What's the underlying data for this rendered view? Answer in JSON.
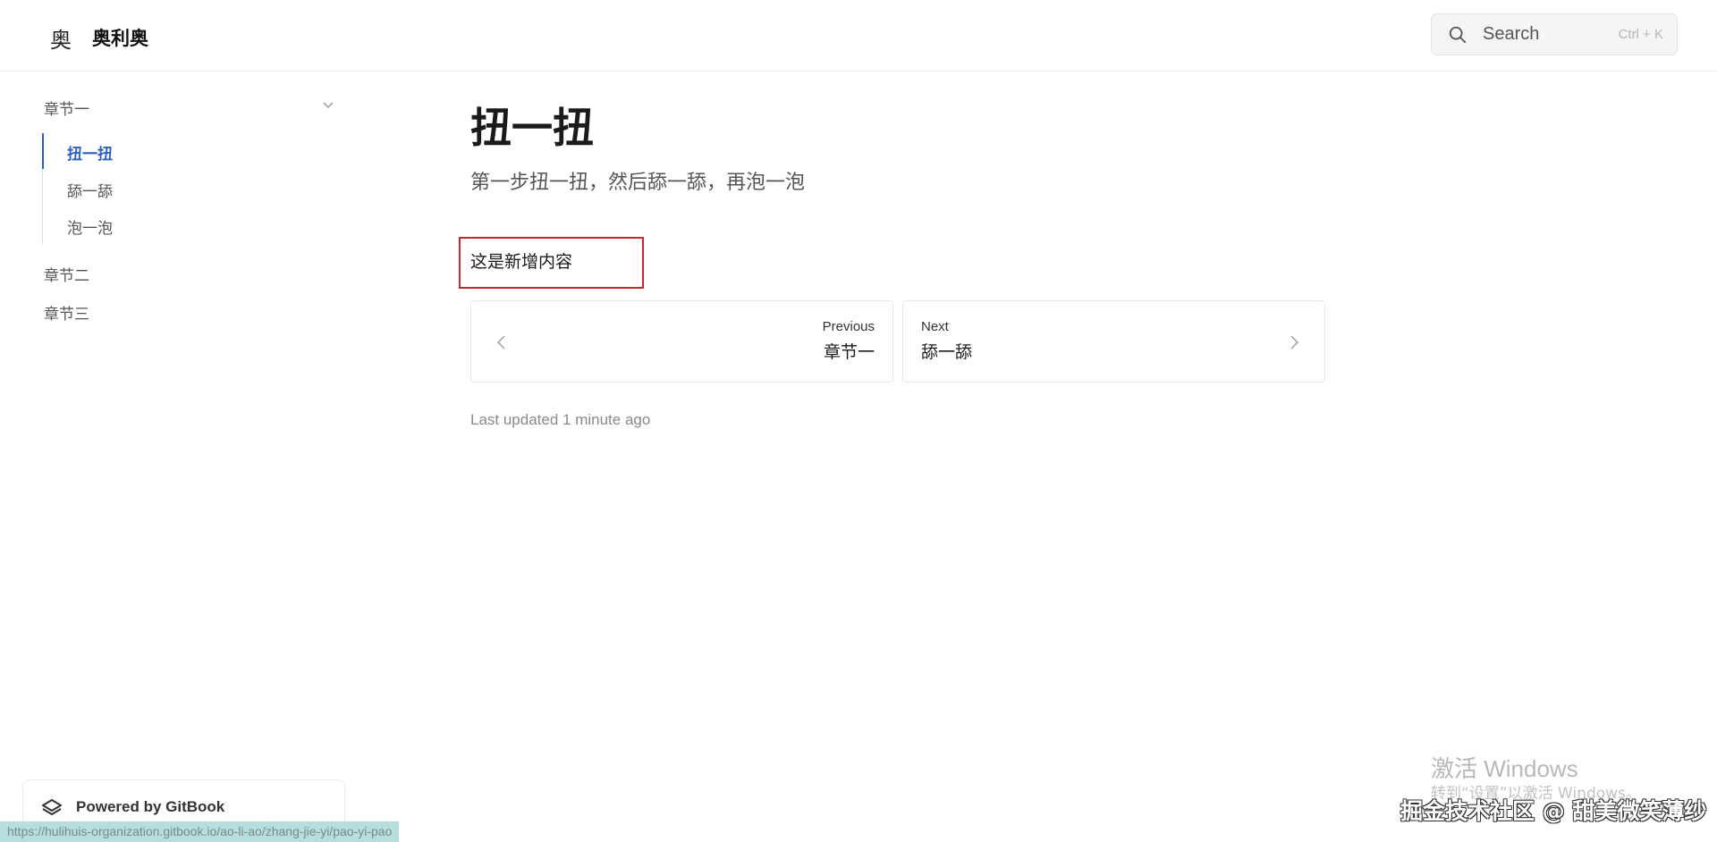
{
  "header": {
    "logo_glyph": "奥",
    "site_title": "奥利奥",
    "search": {
      "placeholder": "Search",
      "shortcut": "Ctrl + K"
    }
  },
  "sidebar": {
    "sections": [
      {
        "label": "章节一",
        "expanded": true,
        "items": [
          {
            "label": "扭一扭",
            "active": true
          },
          {
            "label": "舔一舔",
            "active": false
          },
          {
            "label": "泡一泡",
            "active": false
          }
        ]
      },
      {
        "label": "章节二",
        "expanded": false
      },
      {
        "label": "章节三",
        "expanded": false
      }
    ]
  },
  "main": {
    "title": "扭一扭",
    "description": "第一步扭一扭，然后舔一舔，再泡一泡",
    "body": "这是新增内容",
    "prev": {
      "small": "Previous",
      "label": "章节一"
    },
    "next": {
      "small": "Next",
      "label": "舔一舔"
    },
    "last_updated": "Last updated 1 minute ago"
  },
  "footer": {
    "powered_by": "Powered by GitBook",
    "status_url": "https://hulihuis-organization.gitbook.io/ao-li-ao/zhang-jie-yi/pao-yi-pao"
  },
  "overlay": {
    "activate_title": "激活 Windows",
    "activate_sub": "转到“设置”以激活 Windows。",
    "watermark": "掘金技术社区 @ 甜美微笑薄纱"
  },
  "colors": {
    "accent": "#2f5ec4",
    "highlight_border": "#c9262f",
    "status_bg": "#b6dedd"
  }
}
